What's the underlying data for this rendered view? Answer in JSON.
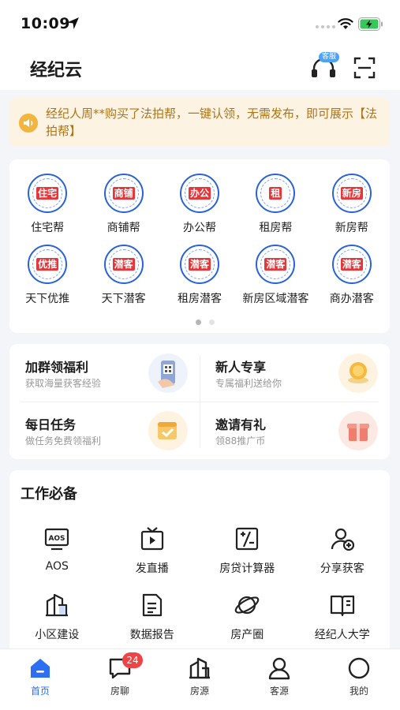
{
  "status_bar": {
    "time": "10:09"
  },
  "header": {
    "title": "经纪云",
    "service_badge": "客服"
  },
  "notice": {
    "text": "经纪人周**购买了法拍帮，一键认领，无需发布，即可展示【法拍帮】"
  },
  "products": [
    {
      "seal": "住宅",
      "label": "住宅帮"
    },
    {
      "seal": "商铺",
      "label": "商铺帮"
    },
    {
      "seal": "办公",
      "label": "办公帮"
    },
    {
      "seal": "租",
      "label": "租房帮"
    },
    {
      "seal": "新房",
      "label": "新房帮"
    },
    {
      "seal": "优推",
      "label": "天下优推"
    },
    {
      "seal": "潜客",
      "label": "天下潜客"
    },
    {
      "seal": "潜客",
      "label": "租房潜客"
    },
    {
      "seal": "潜客",
      "label": "新房区域潜客"
    },
    {
      "seal": "潜客",
      "label": "商办潜客"
    }
  ],
  "promos": [
    {
      "title": "加群领福利",
      "subtitle": "获取海量获客经验"
    },
    {
      "title": "新人专享",
      "subtitle": "专属福利送给你"
    },
    {
      "title": "每日任务",
      "subtitle": "做任务免费领福利"
    },
    {
      "title": "邀请有礼",
      "subtitle": "领88推广币"
    }
  ],
  "tools": {
    "title": "工作必备",
    "items": [
      {
        "label": "AOS",
        "icon": "aos-icon"
      },
      {
        "label": "发直播",
        "icon": "live-icon"
      },
      {
        "label": "房贷计算器",
        "icon": "calculator-icon"
      },
      {
        "label": "分享获客",
        "icon": "share-user-icon"
      },
      {
        "label": "小区建设",
        "icon": "building-icon"
      },
      {
        "label": "数据报告",
        "icon": "report-icon"
      },
      {
        "label": "房产圈",
        "icon": "planet-icon"
      },
      {
        "label": "经纪人大学",
        "icon": "book-icon"
      }
    ]
  },
  "tabbar": {
    "items": [
      {
        "label": "首页",
        "icon": "home-icon",
        "active": true
      },
      {
        "label": "房聊",
        "icon": "chat-icon",
        "badge": "24"
      },
      {
        "label": "房源",
        "icon": "house-icon"
      },
      {
        "label": "客源",
        "icon": "person-icon"
      },
      {
        "label": "我的",
        "icon": "profile-icon"
      }
    ]
  },
  "colors": {
    "accent": "#2d6ff2",
    "notice_bg": "#fdf3e3",
    "notice_text": "#b07418",
    "badge": "#f04444"
  }
}
